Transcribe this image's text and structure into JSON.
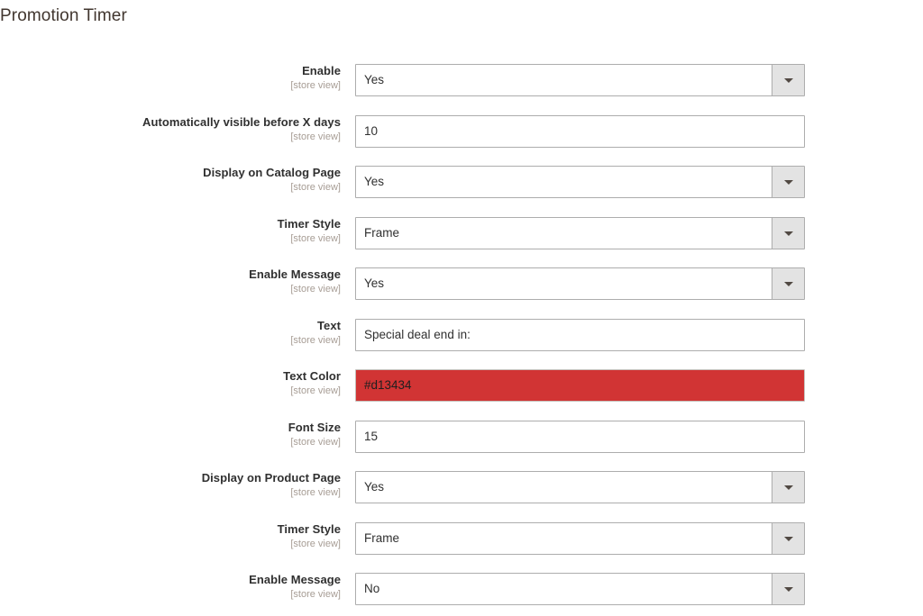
{
  "page": {
    "title": "Promotion Timer"
  },
  "scope_label": "[store view]",
  "colors": {
    "text_color_value": "#d13434",
    "title_color": "#41362f",
    "label_color": "#303030",
    "scope_color": "#a79d95",
    "select_button_bg": "#e3e3e3",
    "input_border": "#adadad"
  },
  "icons": {
    "select_caret": "chevron-down-icon"
  },
  "fields": [
    {
      "label": "Enable",
      "scope": "[store view]",
      "type": "select",
      "value": "Yes",
      "name": "enable"
    },
    {
      "label": "Automatically visible before X days",
      "scope": "[store view]",
      "type": "text",
      "value": "10",
      "name": "automatically-visible-before-x-days"
    },
    {
      "label": "Display on Catalog Page",
      "scope": "[store view]",
      "type": "select",
      "value": "Yes",
      "name": "display-on-catalog-page"
    },
    {
      "label": "Timer Style",
      "scope": "[store view]",
      "type": "select",
      "value": "Frame",
      "name": "timer-style-catalog"
    },
    {
      "label": "Enable Message",
      "scope": "[store view]",
      "type": "select",
      "value": "Yes",
      "name": "enable-message-catalog"
    },
    {
      "label": "Text",
      "scope": "[store view]",
      "type": "text",
      "value": "Special deal end in:",
      "name": "text"
    },
    {
      "label": "Text Color",
      "scope": "[store view]",
      "type": "color",
      "value": "#d13434",
      "name": "text-color"
    },
    {
      "label": "Font Size",
      "scope": "[store view]",
      "type": "text",
      "value": "15",
      "name": "font-size"
    },
    {
      "label": "Display on Product Page",
      "scope": "[store view]",
      "type": "select",
      "value": "Yes",
      "name": "display-on-product-page"
    },
    {
      "label": "Timer Style",
      "scope": "[store view]",
      "type": "select",
      "value": "Frame",
      "name": "timer-style-product"
    },
    {
      "label": "Enable Message",
      "scope": "[store view]",
      "type": "select",
      "value": "No",
      "name": "enable-message-product"
    }
  ]
}
